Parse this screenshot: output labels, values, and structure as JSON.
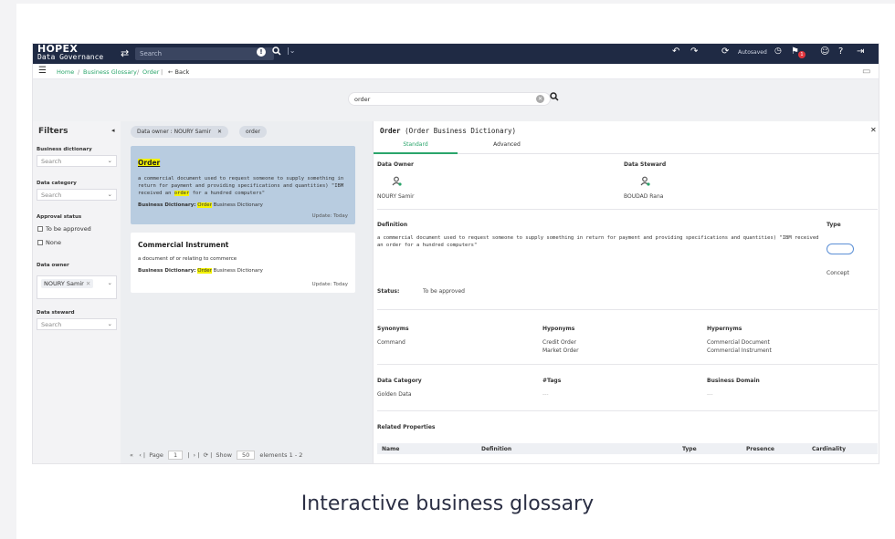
{
  "topbar": {
    "logo_line1": "HOPEX",
    "logo_line2": "Data Governance",
    "search_placeholder": "Search",
    "autosaved": "Autosaved",
    "notification_count": "1"
  },
  "breadcrumb": {
    "home": "Home",
    "section": "Business Glossary",
    "current": "Order",
    "back": "Back"
  },
  "main_search": {
    "value": "order"
  },
  "filters": {
    "title": "Filters",
    "business_dictionary": {
      "label": "Business dictionary",
      "value": "Search"
    },
    "data_category": {
      "label": "Data category",
      "value": "Search"
    },
    "approval_status": {
      "label": "Approval status",
      "options": [
        "To be approved",
        "None"
      ]
    },
    "data_owner": {
      "label": "Data owner",
      "chip": "NOURY Samir"
    },
    "data_steward": {
      "label": "Data steward",
      "value": "Search"
    }
  },
  "results": {
    "active_tags": [
      "Data owner : NOURY Samir",
      "order"
    ],
    "items": [
      {
        "title": "Order",
        "desc_before": "a commercial document used to request someone to supply something in return for payment and providing specifications and quantities) \"IBM received an ",
        "desc_highlight": "order",
        "desc_after": " for a hundred computers\"",
        "dict_label": "Business Dictionary:",
        "dict_highlight": "Order",
        "dict_rest": " Business Dictionary",
        "update": "Update:  Today"
      },
      {
        "title": "Commercial Instrument",
        "desc": "a document of or relating to commerce",
        "dict_label": "Business Dictionary:",
        "dict_highlight": "Order",
        "dict_rest": " Business Dictionary",
        "update": "Update:  Today"
      }
    ],
    "pager": {
      "page_label": "Page",
      "page": "1",
      "show_label": "Show",
      "show": "50",
      "elements": "elements  1 - 2"
    }
  },
  "details": {
    "title": "Order",
    "subtitle": "(Order Business Dictionary)",
    "tabs": [
      "Standard",
      "Advanced"
    ],
    "data_owner": {
      "label": "Data Owner",
      "name": "NOURY Samir"
    },
    "data_steward": {
      "label": "Data Steward",
      "name": "BOUDAD Rana"
    },
    "definition": {
      "label": "Definition",
      "text": "a commercial document used to request someone to supply something in return for payment and providing specifications and quantities) \"IBM received an order for a hundred computers\""
    },
    "type": {
      "label": "Type",
      "value": "Concept"
    },
    "status": {
      "label": "Status:",
      "value": "To be approved"
    },
    "synonyms": {
      "label": "Synonyms",
      "values": [
        "Command"
      ]
    },
    "hyponyms": {
      "label": "Hyponyms",
      "values": [
        "Credit Order",
        "Market Order"
      ]
    },
    "hypernyms": {
      "label": "Hypernyms",
      "values": [
        "Commercial Document",
        "Commercial Instrument"
      ]
    },
    "data_category": {
      "label": "Data Category",
      "value": "Golden Data"
    },
    "tags": {
      "label": "#Tags",
      "value": "---"
    },
    "business_domain": {
      "label": "Business Domain",
      "value": "---"
    },
    "related_properties": {
      "label": "Related Properties",
      "columns": [
        "Name",
        "Definition",
        "Type",
        "Presence",
        "Cardinality"
      ]
    }
  },
  "caption": "Interactive business glossary",
  "colors": {
    "topbar": "#1f2a44",
    "accent_green": "#2aa56b",
    "selected_card": "#b8cce0",
    "highlight": "#f3f200"
  }
}
